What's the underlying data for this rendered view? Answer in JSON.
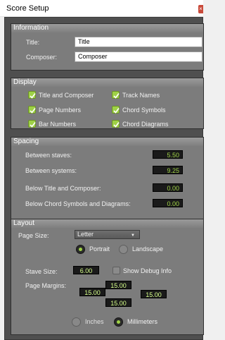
{
  "window": {
    "title": "Score Setup",
    "close_symbol": "×"
  },
  "information": {
    "header": "Information",
    "title_label": "Title:",
    "title_value": "Title",
    "composer_label": "Composer:",
    "composer_value": "Composer"
  },
  "display": {
    "header": "Display",
    "title_and_composer": "Title and Composer",
    "page_numbers": "Page Numbers",
    "bar_numbers": "Bar Numbers",
    "track_names": "Track Names",
    "chord_symbols": "Chord Symbols",
    "chord_diagrams": "Chord Diagrams"
  },
  "spacing": {
    "header": "Spacing",
    "between_staves_label": "Between staves:",
    "between_staves_value": "5.50",
    "between_systems_label": "Between systems:",
    "between_systems_value": "9.25",
    "below_title_label": "Below Title and Composer:",
    "below_title_value": "0.00",
    "below_chord_label": "Below Chord Symbols and Diagrams:",
    "below_chord_value": "0.00"
  },
  "layout": {
    "header": "Layout",
    "page_size_label": "Page Size:",
    "page_size_value": "Letter",
    "portrait_label": "Portrait",
    "landscape_label": "Landscape",
    "stave_size_label": "Stave Size:",
    "stave_size_value": "6.00",
    "show_debug_label": "Show Debug Info",
    "page_margins_label": "Page Margins:",
    "margin_top": "15.00",
    "margin_left": "15.00",
    "margin_right": "15.00",
    "margin_bottom": "15.00",
    "inches_label": "Inches",
    "millimeters_label": "Millimeters"
  },
  "colors": {
    "accent_green": "#9ed146",
    "panel_gray": "#7c7c7c",
    "background_dark": "#4f4f4f"
  }
}
